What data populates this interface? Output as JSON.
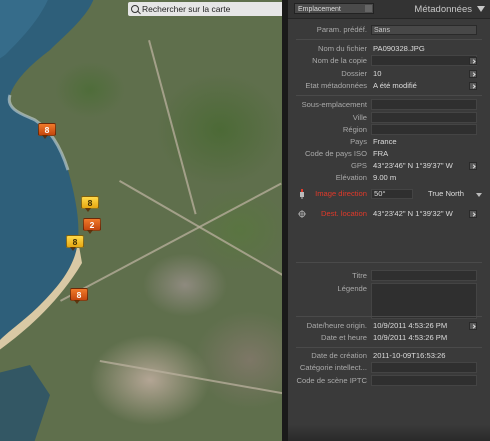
{
  "map": {
    "search_label": "Rechercher sur la carte",
    "markers": [
      {
        "label": "8",
        "color": "orange"
      },
      {
        "label": "8",
        "color": "yellow"
      },
      {
        "label": "2",
        "color": "orange"
      },
      {
        "label": "8",
        "color": "yellow"
      },
      {
        "label": "8",
        "color": "orange"
      }
    ]
  },
  "panel": {
    "preset_dropdown": "Emplacement",
    "title": "Métadonnées",
    "preset": {
      "label": "Param. prédéf.",
      "value": "Sans"
    },
    "file": [
      {
        "label": "Nom du fichier",
        "value": "PA090328.JPG"
      },
      {
        "label": "Nom de la copie",
        "value": ""
      },
      {
        "label": "Dossier",
        "value": "10"
      },
      {
        "label": "Etat métadonnées",
        "value": "A été modifié"
      }
    ],
    "location": [
      {
        "label": "Sous-emplacement",
        "value": ""
      },
      {
        "label": "Ville",
        "value": ""
      },
      {
        "label": "Région",
        "value": ""
      },
      {
        "label": "Pays",
        "value": "France"
      },
      {
        "label": "Code de pays ISO",
        "value": "FRA"
      },
      {
        "label": "GPS",
        "value": "43°23'46\" N 1°39'37\" W"
      },
      {
        "label": "Elévation",
        "value": "9.00 m"
      }
    ],
    "direction": {
      "label": "Image direction",
      "value": "50°",
      "reference": "True North"
    },
    "dest": {
      "label": "Dest. location",
      "value": "43°23'42\" N 1°39'32\" W"
    },
    "caption": [
      {
        "label": "Titre",
        "value": ""
      },
      {
        "label": "Légende",
        "value": ""
      }
    ],
    "dates": [
      {
        "label": "Date/heure origin.",
        "value": "10/9/2011 4:53:26 PM"
      },
      {
        "label": "Date et heure",
        "value": "10/9/2011 4:53:26 PM"
      }
    ],
    "iptc": [
      {
        "label": "Date de création",
        "value": "2011-10-09T16:53:26"
      },
      {
        "label": "Catégorie intellect...",
        "value": ""
      },
      {
        "label": "Code de scène IPTC",
        "value": ""
      }
    ],
    "accent_red": "#e0392a"
  }
}
